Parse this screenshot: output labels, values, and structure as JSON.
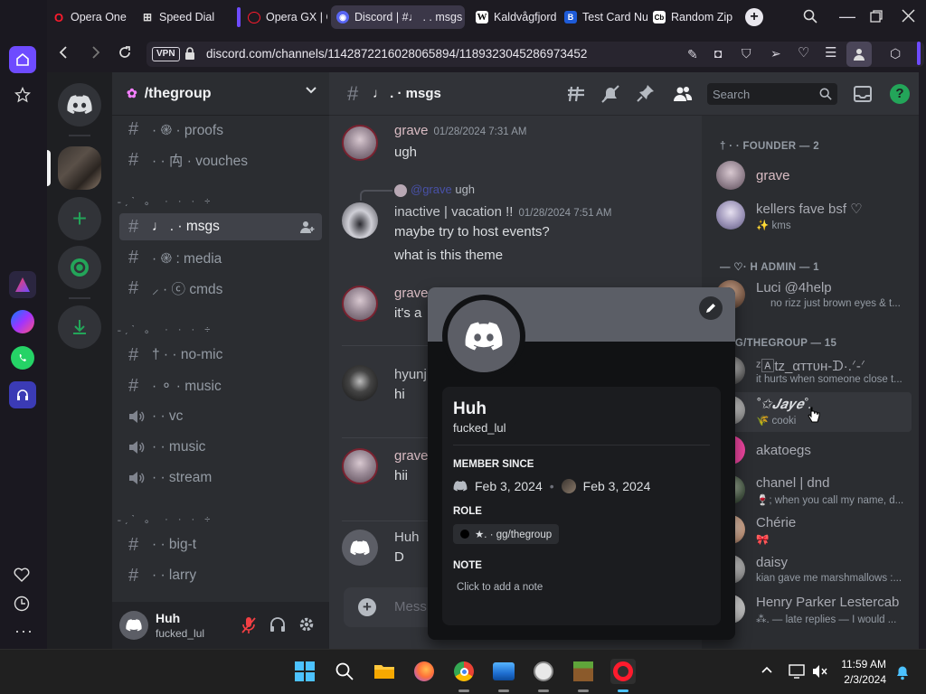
{
  "browser": {
    "tabs": [
      {
        "label": "Opera One",
        "icon": "opera-icon"
      },
      {
        "label": "Speed Dial",
        "icon": "grid-icon"
      },
      {
        "label": "Opera GX | G",
        "icon": "opera-gx-icon"
      },
      {
        "label": "Discord | #♩ . . msgs",
        "icon": "discord-icon"
      },
      {
        "label": "Kaldvågfjord",
        "icon": "wikipedia-icon"
      },
      {
        "label": "Test Card Nu",
        "icon": "b-icon"
      },
      {
        "label": "Random Zip",
        "icon": "cb-icon"
      }
    ],
    "url": "discord.com/channels/1142872216028065894/1189323045286973452",
    "vpn": "VPN"
  },
  "guild": {
    "name": "/thegroup"
  },
  "channels": [
    {
      "icon": "#",
      "label": "· ֎ · proofs"
    },
    {
      "icon": "#",
      "label": "· · ⽱ · vouches"
    },
    {
      "icon": "#",
      "label": "♩ . · msgs"
    },
    {
      "icon": "#",
      "label": "· ֎ : media"
    },
    {
      "icon": "#",
      "label": "⸝ · ⓒ cmds"
    },
    {
      "icon": "#",
      "label": "† · · no-mic"
    },
    {
      "icon": "#",
      "label": "· ⚬ · music"
    },
    {
      "icon": "speaker",
      "label": "· · vc"
    },
    {
      "icon": "speaker",
      "label": "· · music"
    },
    {
      "icon": "speaker",
      "label": "· · stream"
    },
    {
      "icon": "#",
      "label": "· · big-t"
    },
    {
      "icon": "#",
      "label": "· · larry"
    }
  ],
  "category_sep": "˗ˏˋ  。  ·  ·  ·  ÷",
  "user": {
    "name": "Huh",
    "tag": "fucked_lul"
  },
  "chat": {
    "channel": "♩ . · msgs",
    "search_placeholder": "Search",
    "messages": [
      {
        "author": "grave",
        "time": "01/28/2024 7:31 AM",
        "lines": [
          "ugh"
        ]
      },
      {
        "reply_to": "@grave",
        "reply_text": "ugh",
        "author": "inactive | vacation !!",
        "time": "01/28/2024 7:51 AM",
        "lines": [
          "maybe try to host events?",
          "what is this theme"
        ]
      },
      {
        "author": "grave",
        "time": "",
        "lines": [
          "it's a"
        ]
      },
      {
        "author": "hyunj",
        "time": "",
        "lines": [
          "hi"
        ]
      },
      {
        "author": "grave",
        "time": "",
        "lines": [
          "hii"
        ]
      },
      {
        "author": "Huh",
        "time": "",
        "lines": [
          "D"
        ]
      }
    ],
    "composer_placeholder": "Mess"
  },
  "members": {
    "groups": [
      {
        "title": "† · · FOUNDER — 2",
        "items": [
          {
            "name": "grave",
            "status": ""
          },
          {
            "name": "kellers fave bsf ♡",
            "status": "✨ kms"
          }
        ]
      },
      {
        "title": "— ♡· H ADMIN — 1",
        "items": [
          {
            "name": "Luci @4help",
            "status": "no rizz just brown eyes & t..."
          }
        ]
      },
      {
        "title": "· GG/THEGROUP — 15",
        "items": [
          {
            "name": "ᶻ🄰tz_αттυн-ᗪ·.ᐟ-ᐟ",
            "status": "it hurts when someone close t..."
          },
          {
            "name": "˚✩𝑱𝒂𝒚𝒆˚.",
            "status": "🌾 cooki"
          },
          {
            "name": "akatoegs",
            "status": ""
          },
          {
            "name": "chanel | dnd",
            "status": "🍷; when you call my name, d..."
          },
          {
            "name": "Chérie",
            "status": "🎀"
          },
          {
            "name": "daisy",
            "status": "kian gave me marshmallows :..."
          },
          {
            "name": "Henry Parker Lestercab",
            "status": "⁂. — late replies — I would ..."
          }
        ]
      }
    ]
  },
  "popout": {
    "display_name": "Huh",
    "username": "fucked_lul",
    "member_since_label": "MEMBER SINCE",
    "discord_date": "Feb 3, 2024",
    "server_date": "Feb 3, 2024",
    "role_label": "ROLE",
    "role": "★. · gg/thegroup",
    "note_label": "NOTE",
    "note_placeholder": "Click to add a note"
  },
  "taskbar": {
    "time": "11:59 AM",
    "date": "2/3/2024"
  },
  "colors": {
    "blurple": "#5865f2",
    "green": "#23a559",
    "opera_red": "#ff1b2d"
  }
}
